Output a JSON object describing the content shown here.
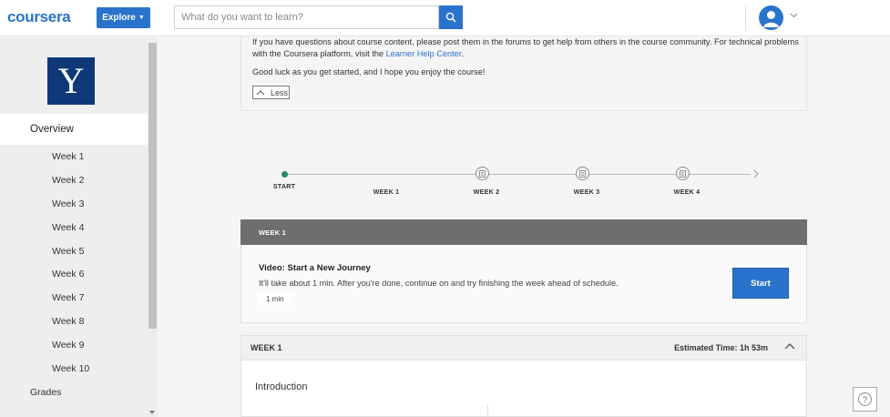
{
  "header": {
    "logo": "coursera",
    "explore_label": "Explore",
    "search_placeholder": "What do you want to learn?",
    "brand_color": "#2a73cc"
  },
  "sidebar": {
    "university_logo_letter": "Y",
    "overview_label": "Overview",
    "weeks": [
      "Week 1",
      "Week 2",
      "Week 3",
      "Week 4",
      "Week 5",
      "Week 6",
      "Week 7",
      "Week 8",
      "Week 9",
      "Week 10"
    ],
    "grades_label": "Grades"
  },
  "intro_card": {
    "paragraph1_text": "If you have questions about course content, please post them in the forums to get help from others in the course community. For technical problems with the Coursera platform, visit the ",
    "paragraph1_link": "Learner Help Center",
    "paragraph1_end": ".",
    "paragraph2": "Good luck as you get started, and I hope you enjoy the course!",
    "less_label": "Less"
  },
  "timeline": {
    "start_label": "START",
    "weeks": [
      "WEEK 1",
      "WEEK 2",
      "WEEK 3",
      "WEEK 4"
    ]
  },
  "current_week": {
    "header": "WEEK 1",
    "item_title": "Video: Start a New Journey",
    "item_description": "It'll take about 1 min. After you're done, continue on and try finishing the week ahead of schedule.",
    "duration": "1 min",
    "start_label": "Start"
  },
  "week_detail": {
    "header": "WEEK 1",
    "estimated_time": "Estimated Time: 1h 53m",
    "section_title": "Introduction"
  },
  "help_label": "?"
}
